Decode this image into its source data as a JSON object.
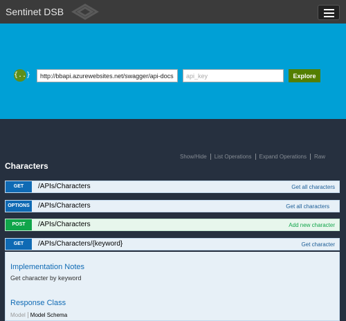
{
  "app": {
    "title": "Sentinet DSB"
  },
  "explorer": {
    "url": "http://bbapi.azurewebsites.net/swagger/api-docs",
    "api_key_placeholder": "api_key",
    "explore_label": "Explore",
    "brace_glyph": "{..}"
  },
  "op_links": [
    "Show/Hide",
    "List Operations",
    "Expand Operations",
    "Raw"
  ],
  "resource": {
    "name": "Characters",
    "operations": [
      {
        "method": "GET",
        "path": "/APIs/Characters",
        "summary": "Get all characters"
      },
      {
        "method": "OPTIONS",
        "path": "/APIs/Characters",
        "summary": "Get all characters"
      },
      {
        "method": "POST",
        "path": "/APIs/Characters",
        "summary": "Add new character"
      },
      {
        "method": "GET",
        "path": "/APIs/Characters/{keyword}",
        "summary": "Get character"
      }
    ]
  },
  "details": {
    "impl_heading": "Implementation Notes",
    "impl_text": "Get character by keyword",
    "response_heading": "Response Class",
    "tab_model": "Model",
    "tab_schema": "Model Schema"
  },
  "colors": {
    "topbar": "#3b3b3b",
    "hero": "#00a0d6",
    "body": "#26303f",
    "get": "#0f6ab4",
    "post": "#10a54a",
    "explore": "#547f00"
  }
}
